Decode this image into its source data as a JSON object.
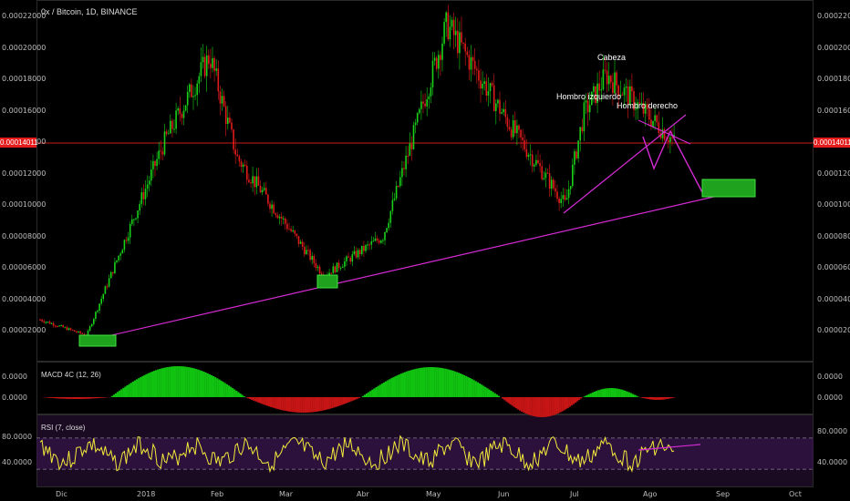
{
  "chart": {
    "title": "0x / Bitcoin, 1D, BINANCE",
    "current_price": "0.00014011",
    "price_axis": [
      "0.00022000",
      "0.00020000",
      "0.00018000",
      "0.00016000",
      "0.00014000",
      "0.00012000",
      "0.00010000",
      "0.00008000",
      "0.00006000",
      "0.00004000",
      "0.00002000"
    ],
    "time_axis": [
      "Dic",
      "2018",
      "Feb",
      "Mar",
      "Abr",
      "May",
      "Jun",
      "Jul",
      "Ago",
      "Sep",
      "Oct"
    ],
    "annotations": {
      "head": "Cabeza",
      "left_shoulder": "Hombro izquierdo",
      "right_shoulder": "Hombro derecho"
    }
  },
  "macd": {
    "title": "MACD 4C (12, 26)",
    "axis": [
      "0.0000",
      "0.0000"
    ]
  },
  "rsi": {
    "title": "RSI (7, close)",
    "axis": [
      "80.0000",
      "40.0000"
    ]
  },
  "colors": {
    "up": "#19d119",
    "down": "#e01b1b",
    "trendline": "#d42bd4",
    "rsi_line": "#f2ea3a",
    "box": "#1fa31f"
  },
  "chart_data": {
    "type": "candlestick",
    "price_range": [
      0,
      0.00022
    ],
    "key_points": [
      {
        "x": "Nov",
        "y": 2.7e-05
      },
      {
        "x": "Dic",
        "y": 1.7e-05
      },
      {
        "x": "2018",
        "y": 0.00014
      },
      {
        "x": "Ene",
        "y": 0.000195
      },
      {
        "x": "Feb",
        "y": 0.00013
      },
      {
        "x": "Mar",
        "y": 5.5e-05
      },
      {
        "x": "Abr",
        "y": 8e-05
      },
      {
        "x": "May",
        "y": 0.000215
      },
      {
        "x": "Jun",
        "y": 0.00015
      },
      {
        "x": "Jul",
        "y": 0.0001
      },
      {
        "x": "Jul",
        "y": 0.000158
      },
      {
        "x": "Jul",
        "y": 0.000183
      },
      {
        "x": "Ago",
        "y": 0.00014
      }
    ]
  }
}
